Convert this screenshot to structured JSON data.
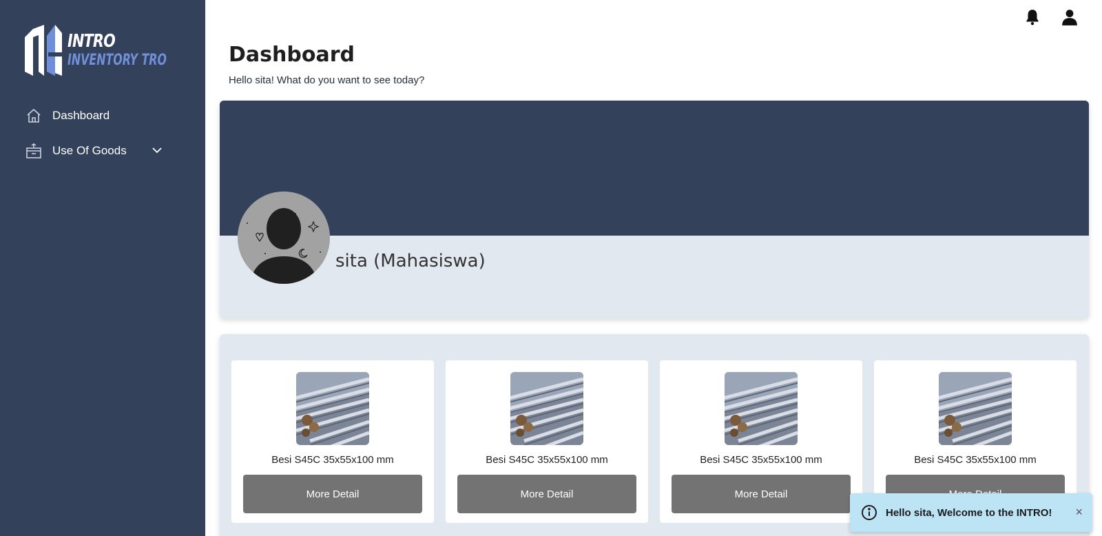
{
  "brand": {
    "title": "INTRO",
    "subtitle": "INVENTORY TRO",
    "colors": {
      "sidebar": "#33425a",
      "accent": "#6f8fd8"
    }
  },
  "sidebar": {
    "items": [
      {
        "label": "Dashboard",
        "icon": "home-icon"
      },
      {
        "label": "Use Of Goods",
        "icon": "box-icon",
        "expand_icon": "chevron-down-icon"
      }
    ]
  },
  "topbar": {
    "icons": [
      "bell-icon",
      "user-icon"
    ]
  },
  "header": {
    "title": "Dashboard",
    "subtitle": "Hello sita! What do you want to see today?"
  },
  "profile": {
    "name": "sita (Mahasiswa)"
  },
  "goods": {
    "items": [
      {
        "name": "Besi S45C 35x55x100 mm",
        "button": "More Detail"
      },
      {
        "name": "Besi S45C 35x55x100 mm",
        "button": "More Detail"
      },
      {
        "name": "Besi S45C 35x55x100 mm",
        "button": "More Detail"
      },
      {
        "name": "Besi S45C 35x55x100 mm",
        "button": "More Detail"
      }
    ]
  },
  "toast": {
    "message": "Hello sita, Welcome to the INTRO!",
    "close": "×",
    "icon": "info-icon"
  }
}
